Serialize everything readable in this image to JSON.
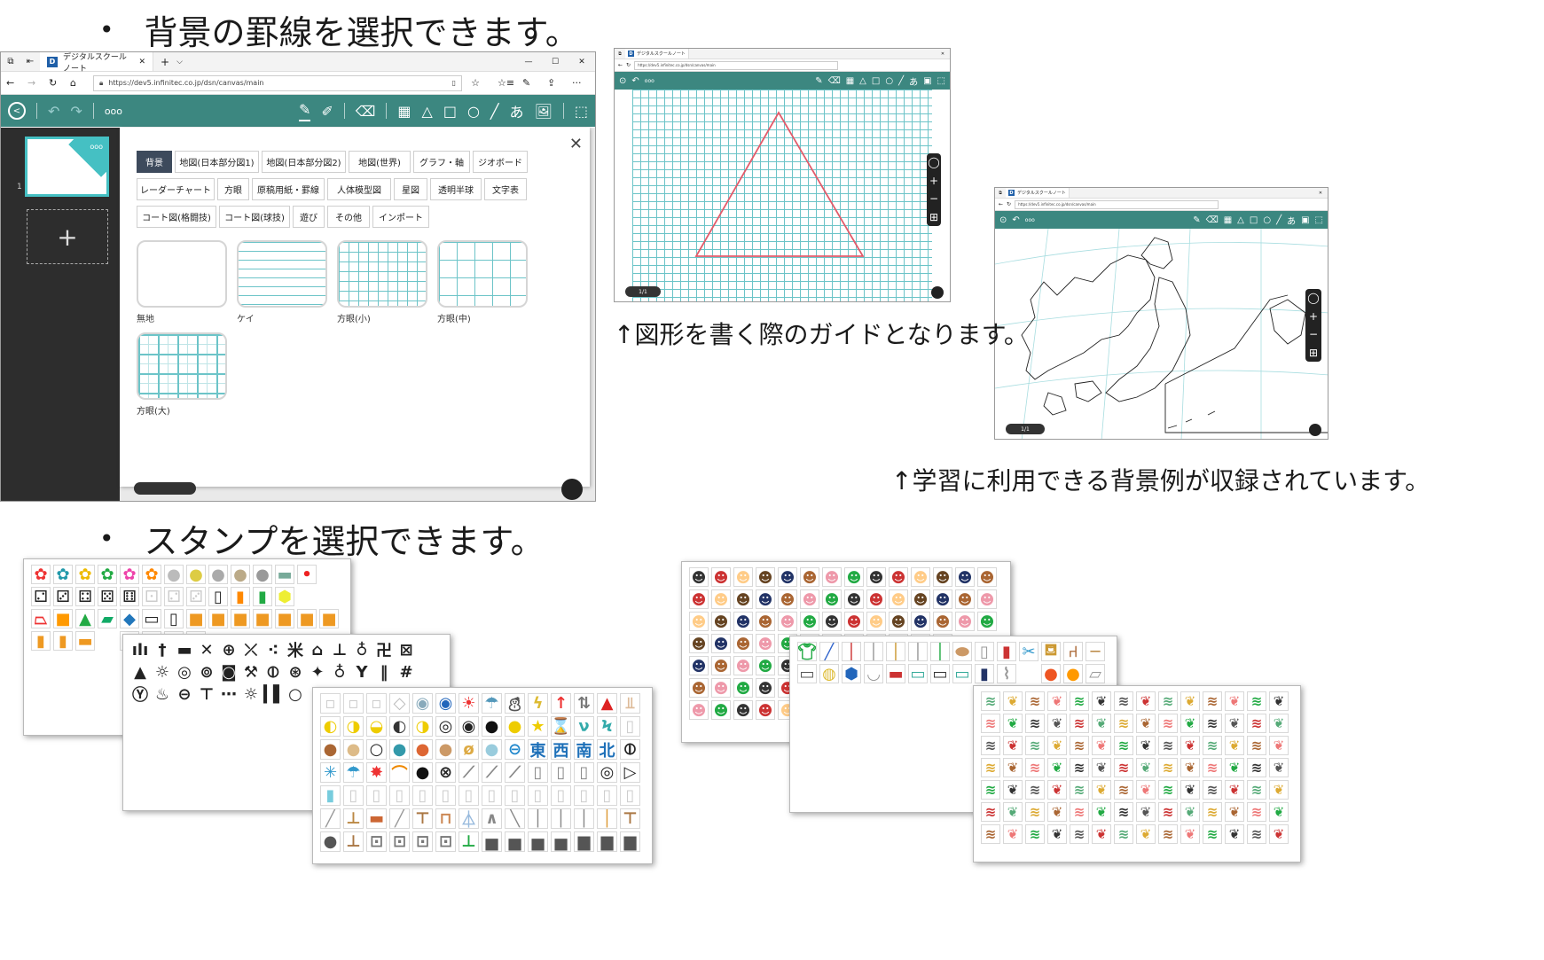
{
  "headings": {
    "background": "背景の罫線を選択できます。",
    "stamps": "スタンプを選択できます。",
    "bullet": "•"
  },
  "captions": {
    "guide": "↑図形を書く際のガイドとなります。",
    "examples": "↑学習に利用できる背景例が収録されています。"
  },
  "browser": {
    "tab_title": "デジタルスクールノート",
    "tab_close": "✕",
    "new_tab": "+",
    "tab_menu": "⌵",
    "url": "https://dev5.infinitec.co.jp/dsn/canvas/main",
    "win_min": "—",
    "win_max": "☐",
    "win_close": "✕",
    "more": "···"
  },
  "app": {
    "more_label": "ooo",
    "page_number": "1",
    "thumb_more": "ooo",
    "add_page": "+",
    "close": "✕",
    "hira_tool": "あ",
    "page_indicator": "1/1"
  },
  "dialog": {
    "categories": [
      "背景",
      "地図(日本部分図1)",
      "地図(日本部分図2)",
      "地図(世界)",
      "グラフ・軸",
      "ジオボード",
      "レーダーチャート",
      "方眼",
      "原稿用紙・罫線",
      "人体模型図",
      "星図",
      "透明半球",
      "文字表",
      "コート図(格闘技)",
      "コート図(球技)",
      "遊び",
      "その他",
      "インポート"
    ],
    "active_category": "背景",
    "backgrounds": [
      "無地",
      "ケイ",
      "方眼(小)",
      "方眼(中)",
      "方眼(大)"
    ]
  },
  "stamp_labels": {
    "east": "東",
    "west": "西",
    "south": "南",
    "north": "北"
  },
  "colors": {
    "toolbar": "#3c8780",
    "sidebar": "#2d2d2d",
    "grid": "#6cc4c8",
    "active_tab": "#3d4a5c",
    "triangle": "#e35a6a"
  }
}
